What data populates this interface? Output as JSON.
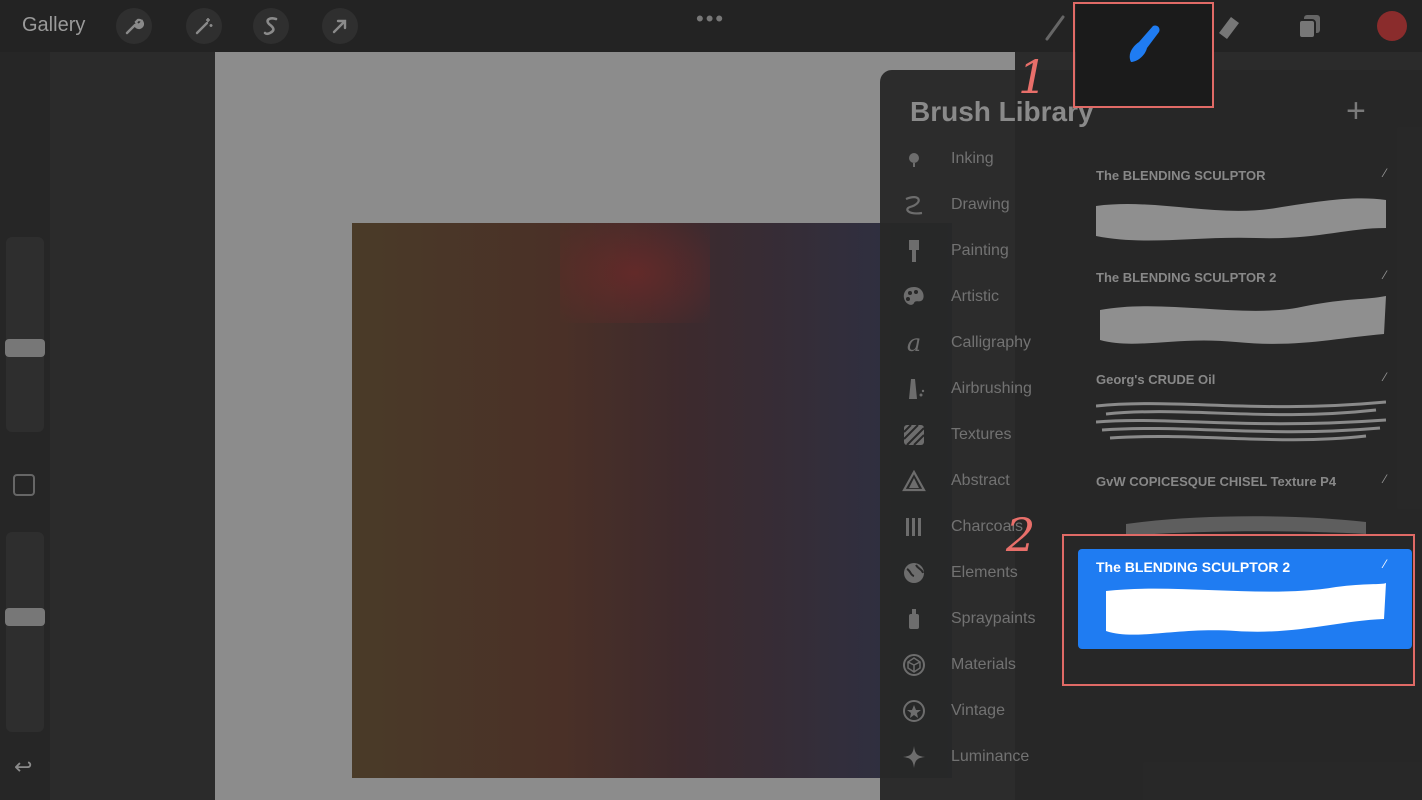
{
  "topbar": {
    "gallery_label": "Gallery",
    "left_tools": [
      "wrench-icon",
      "magic-wand-icon",
      "selection-s-icon",
      "transform-arrow-icon"
    ],
    "more_dots": "•••",
    "right_tools": [
      "pen-icon",
      "brush-icon",
      "eraser-icon",
      "layers-icon",
      "color-swatch"
    ]
  },
  "brush_library": {
    "title": "Brush Library",
    "add_label": "+",
    "categories": [
      {
        "label": "Inking",
        "icon": "ink-drop-icon"
      },
      {
        "label": "Drawing",
        "icon": "squiggle-icon"
      },
      {
        "label": "Painting",
        "icon": "paintbrush-icon"
      },
      {
        "label": "Artistic",
        "icon": "palette-icon"
      },
      {
        "label": "Calligraphy",
        "icon": "calligraphy-icon"
      },
      {
        "label": "Airbrushing",
        "icon": "airbrush-icon"
      },
      {
        "label": "Textures",
        "icon": "texture-icon"
      },
      {
        "label": "Abstract",
        "icon": "triangle-icon"
      },
      {
        "label": "Charcoals",
        "icon": "charcoal-icon"
      },
      {
        "label": "Elements",
        "icon": "globe-icon"
      },
      {
        "label": "Spraypaints",
        "icon": "spray-can-icon"
      },
      {
        "label": "Materials",
        "icon": "cube-icon"
      },
      {
        "label": "Vintage",
        "icon": "star-badge-icon"
      },
      {
        "label": "Luminance",
        "icon": "sparkle-icon"
      }
    ],
    "brushes": [
      {
        "name": "The BLENDING SCULPTOR",
        "selected": false
      },
      {
        "name": "The BLENDING SCULPTOR 2",
        "selected": false
      },
      {
        "name": "Georg's CRUDE Oil",
        "selected": false
      },
      {
        "name": "GvW COPICESQUE CHISEL Texture P4",
        "selected": false
      },
      {
        "name": "The BLENDING SCULPTOR 2",
        "selected": true
      }
    ]
  },
  "callouts": {
    "one": "1",
    "two": "2"
  },
  "colors": {
    "accent": "#1f7cf2",
    "highlight": "#e06a66",
    "panel": "#282828"
  }
}
